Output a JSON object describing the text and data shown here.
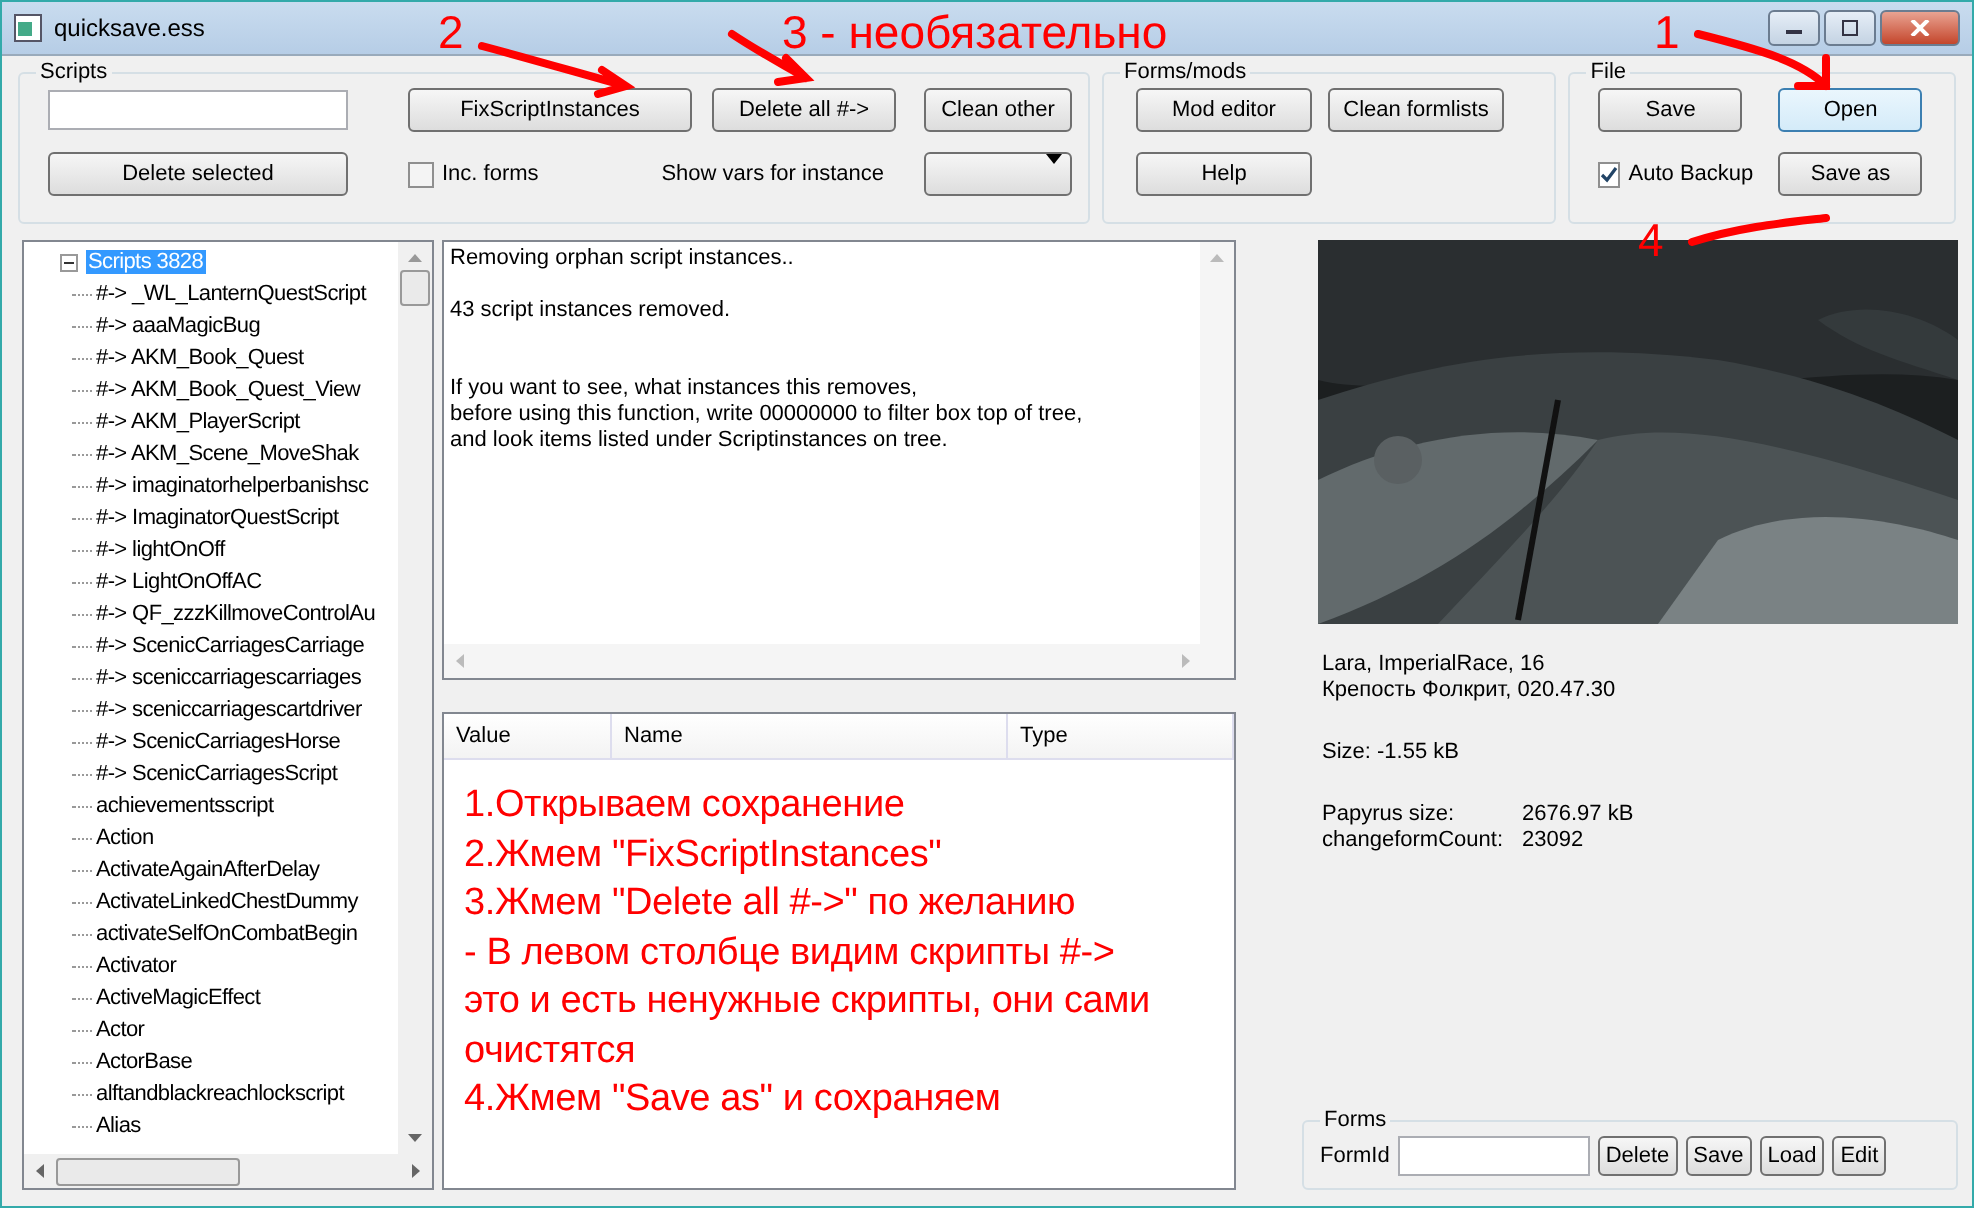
{
  "window": {
    "title": "quicksave.ess"
  },
  "scripts_group": {
    "title": "Scripts",
    "buttons": [
      "FixScriptInstances",
      "Delete all #->",
      "Clean other"
    ],
    "delete_button": "Delete selected",
    "inc_forms": {
      "label": "Inc. forms",
      "checked": false
    },
    "show_vars_label": "Show vars for instance"
  },
  "forms_mods_group": {
    "title": "Forms/mods",
    "buttons": [
      "Mod editor",
      "Clean formlists",
      "Help"
    ]
  },
  "file_group": {
    "title": "File",
    "buttons": [
      {
        "label": "Save",
        "focused": false
      },
      {
        "label": "Open",
        "focused": true
      },
      {
        "label": "Save as",
        "focused": false
      }
    ],
    "auto_backup": {
      "label": "Auto Backup",
      "checked": true
    }
  },
  "tree": {
    "root": {
      "label": "Scripts 3828",
      "selected": true,
      "expanded": true,
      "children": [
        {
          "label": "#-> _WL_LanternQuestScript",
          "selected": false
        },
        {
          "label": "#-> aaaMagicBug",
          "selected": false
        },
        {
          "label": "#-> AKM_Book_Quest",
          "selected": false
        },
        {
          "label": "#-> AKM_Book_Quest_View",
          "selected": false
        },
        {
          "label": "#-> AKM_PlayerScript",
          "selected": false
        },
        {
          "label": "#-> AKM_Scene_MoveShak",
          "selected": false
        },
        {
          "label": "#-> imaginatorhelperbanishsc",
          "selected": false
        },
        {
          "label": "#-> ImaginatorQuestScript",
          "selected": false
        },
        {
          "label": "#-> lightOnOff",
          "selected": false
        },
        {
          "label": "#-> LightOnOffAC",
          "selected": false
        },
        {
          "label": "#-> QF_zzzKillmoveControlAu",
          "selected": false
        },
        {
          "label": "#-> ScenicCarriagesCarriage",
          "selected": false
        },
        {
          "label": "#-> sceniccarriagescarriages",
          "selected": false
        },
        {
          "label": "#-> sceniccarriagescartdriver",
          "selected": false
        },
        {
          "label": "#-> ScenicCarriagesHorse",
          "selected": false
        },
        {
          "label": "#-> ScenicCarriagesScript",
          "selected": false
        },
        {
          "label": "achievementsscript",
          "selected": false
        },
        {
          "label": "Action",
          "selected": false
        },
        {
          "label": "ActivateAgainAfterDelay",
          "selected": false
        },
        {
          "label": "ActivateLinkedChestDummy",
          "selected": false
        },
        {
          "label": "activateSelfOnCombatBegin",
          "selected": false
        },
        {
          "label": "Activator",
          "selected": false
        },
        {
          "label": "ActiveMagicEffect",
          "selected": false
        },
        {
          "label": "Actor",
          "selected": false
        },
        {
          "label": "ActorBase",
          "selected": false
        },
        {
          "label": "alftandblackreachlockscript",
          "selected": false
        },
        {
          "label": "Alias",
          "selected": false
        }
      ]
    }
  },
  "log": [
    "Removing orphan script instances..",
    "43 script instances removed.",
    "If you want to see, what instances this removes,\nbefore using this function, write 00000000 to filter box top of tree,\nand look items listed under Scriptinstances on tree."
  ],
  "table": {
    "columns": [
      "Value",
      "Name",
      "Type"
    ]
  },
  "save_info": {
    "character": "Lara, ImperialRace, 16",
    "location": "Крепость Фолкрит, 020.47.30",
    "size": "Size: -1.55 kB",
    "stats": [
      {
        "label": "Papyrus size:",
        "value": "2676.97 kB"
      },
      {
        "label": "changeformCount:",
        "value": "23092"
      }
    ]
  },
  "forms_group": {
    "title": "Forms",
    "formid_label": "FormId",
    "buttons": [
      "Delete",
      "Save",
      "Load",
      "Edit"
    ]
  },
  "annotations": {
    "markers": [
      "2",
      "3 - необязательно",
      "1",
      "4"
    ],
    "instructions": "1.Открываем сохранение\n2.Жмем \"FixScriptInstances\"\n3.Жмем \"Delete all #->\" по желанию\n- В левом столбце видим скрипты #->\nэто и есть ненужные скрипты, они сами\nочистятся\n4.Жмем \"Save as\" и сохраняем"
  }
}
